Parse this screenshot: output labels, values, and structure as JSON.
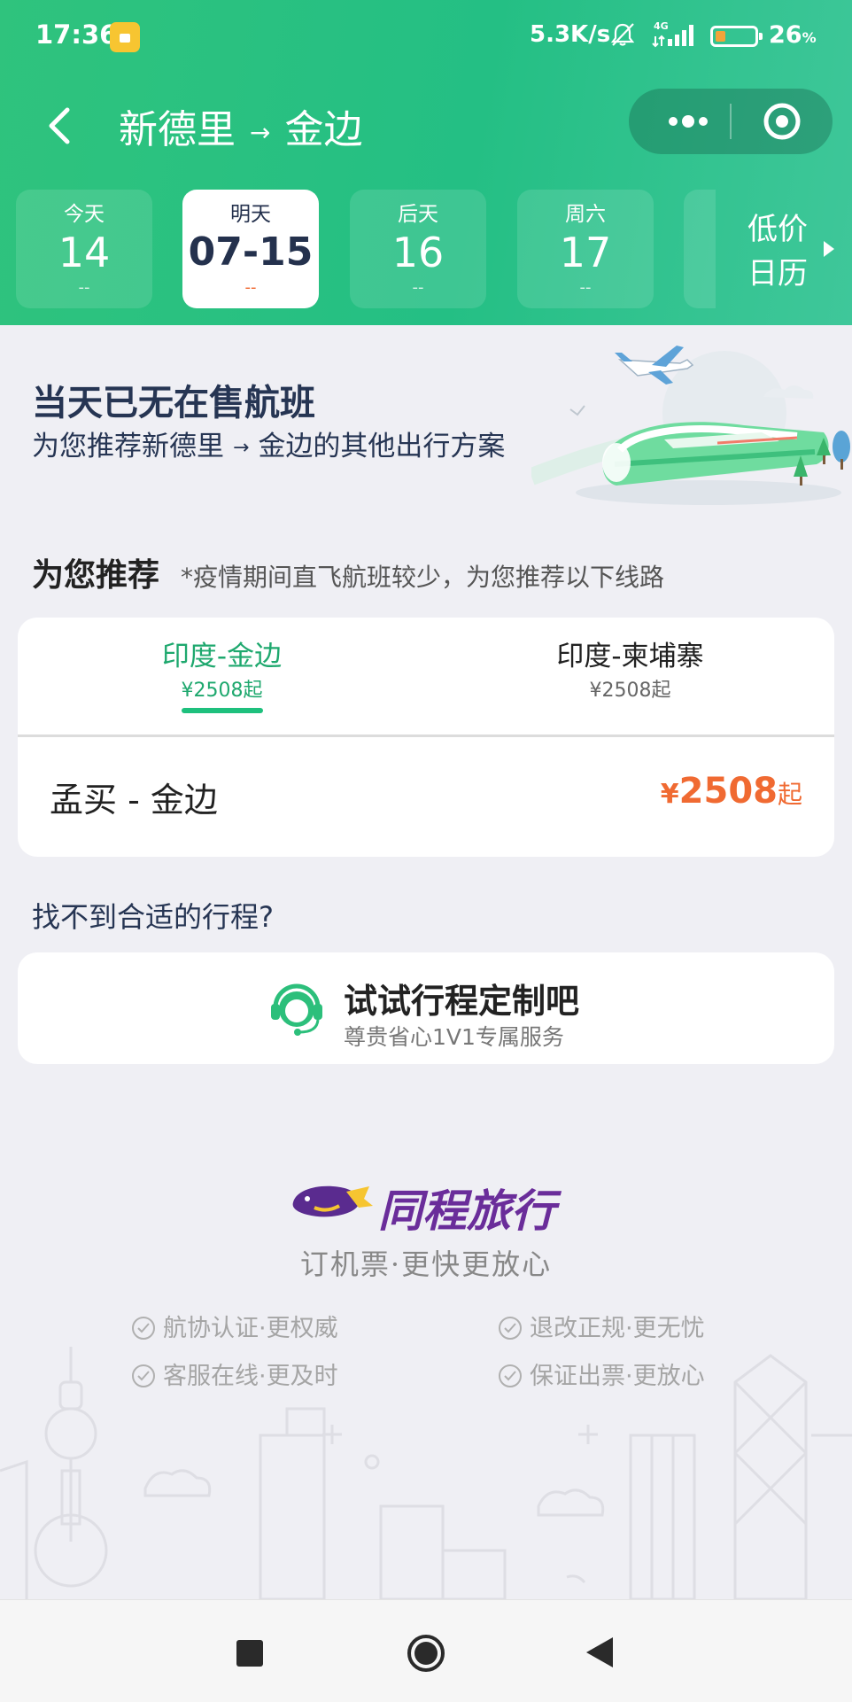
{
  "status_bar": {
    "time": "17:36",
    "net_speed": "5.3K/s",
    "network_type": "4G",
    "battery_percent_value": "26",
    "battery_percent_unit": "%",
    "battery_level": 0.26,
    "icons": [
      "lock-notification-icon",
      "bell-off-icon",
      "signal-icon",
      "battery-icon"
    ]
  },
  "nav": {
    "origin": "新德里",
    "arrow": "→",
    "destination": "金边",
    "icons": [
      "back-arrow-icon",
      "more-dots-icon",
      "target-icon"
    ]
  },
  "date_tabs": [
    {
      "label": "今天",
      "date": "14",
      "price": "--"
    },
    {
      "label": "明天",
      "date": "07-15",
      "price": "--",
      "active": true
    },
    {
      "label": "后天",
      "date": "16",
      "price": "--"
    },
    {
      "label": "周六",
      "date": "17",
      "price": "--"
    }
  ],
  "low_price_calendar": {
    "label": "低价日历"
  },
  "empty_state": {
    "title": "当天已无在售航班",
    "subtitle_prefix": "为您推荐",
    "origin": "新德里",
    "arrow": "→",
    "subtitle_suffix": "金边的其他出行方案"
  },
  "recommend": {
    "title": "为您推荐",
    "note": "*疫情期间直飞航班较少，为您推荐以下线路",
    "tabs": [
      {
        "name": "印度-金边",
        "price": "¥2508起",
        "active": true
      },
      {
        "name": "印度-柬埔寨",
        "price": "¥2508起",
        "active": false
      }
    ],
    "route": {
      "name": "孟买 - 金边",
      "currency": "¥",
      "price": "2508",
      "suffix": "起"
    }
  },
  "custom_trip": {
    "question": "找不到合适的行程?",
    "title": "试试行程定制吧",
    "subtitle": "尊贵省心1V1专属服务"
  },
  "brand": {
    "name": "同程旅行",
    "slogan": "订机票·更快更放心",
    "features": [
      "航协认证·更权威",
      "退改正规·更无忧",
      "客服在线·更及时",
      "保证出票·更放心"
    ]
  },
  "colors": {
    "header_green": "#2fc37d",
    "accent_green": "#1ea86e",
    "price_orange": "#f06a32",
    "title_navy": "#263553",
    "brand_purple": "#6a2d9a"
  }
}
